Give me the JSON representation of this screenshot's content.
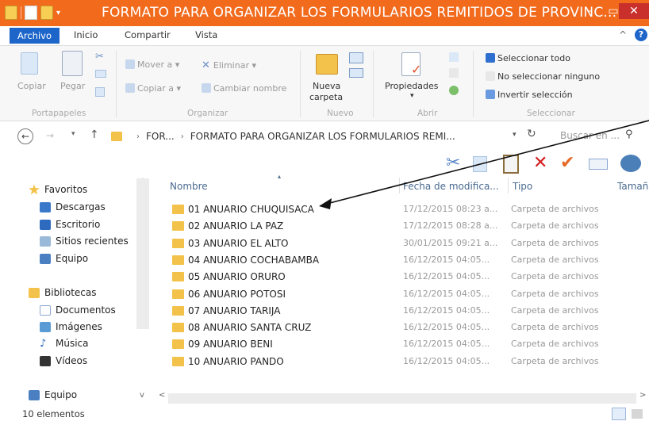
{
  "window": {
    "title": "FORMATO PARA ORGANIZAR LOS FORMULARIOS REMITIDOS DE PROVINC...",
    "minimize": "–",
    "maximize": "▭",
    "close": "✕"
  },
  "ribbon_tabs": [
    "Archivo",
    "Inicio",
    "Compartir",
    "Vista"
  ],
  "ribbon": {
    "copiar": "Copiar",
    "pegar": "Pegar",
    "mover_a": "Mover a ▾",
    "copiar_a": "Copiar a ▾",
    "eliminar": "Eliminar ▾",
    "cambiar_nombre": "Cambiar nombre",
    "nueva_carpeta_1": "Nueva",
    "nueva_carpeta_2": "carpeta",
    "propiedades": "Propiedades",
    "seleccionar_todo": "Seleccionar todo",
    "no_seleccionar": "No seleccionar ninguno",
    "invertir": "Invertir selección",
    "groups": {
      "portapapeles": "Portapapeles",
      "organizar": "Organizar",
      "nuevo": "Nuevo",
      "abrir": "Abrir",
      "seleccionar": "Seleccionar"
    }
  },
  "address": {
    "crumb_1": "FOR...",
    "crumb_2": "FORMATO PARA ORGANIZAR LOS FORMULARIOS REMI...",
    "search_placeholder": "Buscar en ..."
  },
  "sidebar": {
    "favoritos": "Favoritos",
    "favorites_items": [
      "Descargas",
      "Escritorio",
      "Sitios recientes",
      "Equipo"
    ],
    "bibliotecas": "Bibliotecas",
    "library_items": [
      "Documentos",
      "Imágenes",
      "Música",
      "Vídeos"
    ],
    "equipo": "Equipo"
  },
  "columns": {
    "nombre": "Nombre",
    "fecha": "Fecha de modifica...",
    "tipo": "Tipo",
    "tamano": "Tamaño"
  },
  "files": [
    {
      "name": "01 ANUARIO CHUQUISACA",
      "date": "17/12/2015 08:23 a...",
      "type": "Carpeta de archivos"
    },
    {
      "name": "02 ANUARIO LA PAZ",
      "date": "17/12/2015 08:28 a...",
      "type": "Carpeta de archivos"
    },
    {
      "name": "03 ANUARIO EL ALTO",
      "date": "30/01/2015 09:21 a...",
      "type": "Carpeta de archivos"
    },
    {
      "name": "04 ANUARIO COCHABAMBA",
      "date": "16/12/2015 04:05...",
      "type": "Carpeta de archivos"
    },
    {
      "name": "05 ANUARIO ORURO",
      "date": "16/12/2015 04:05...",
      "type": "Carpeta de archivos"
    },
    {
      "name": "06 ANUARIO POTOSI",
      "date": "16/12/2015 04:05...",
      "type": "Carpeta de archivos"
    },
    {
      "name": "07 ANUARIO TARIJA",
      "date": "16/12/2015 04:05...",
      "type": "Carpeta de archivos"
    },
    {
      "name": "08 ANUARIO SANTA CRUZ",
      "date": "16/12/2015 04:05...",
      "type": "Carpeta de archivos"
    },
    {
      "name": "09 ANUARIO BENI",
      "date": "16/12/2015 04:05...",
      "type": "Carpeta de archivos"
    },
    {
      "name": "10 ANUARIO PANDO",
      "date": "16/12/2015 04:05...",
      "type": "Carpeta de archivos"
    }
  ],
  "status": "10 elementos",
  "colors": {
    "titlebar": "#f26b1d",
    "accent": "#1d65c9",
    "folder": "#f3c24a"
  }
}
